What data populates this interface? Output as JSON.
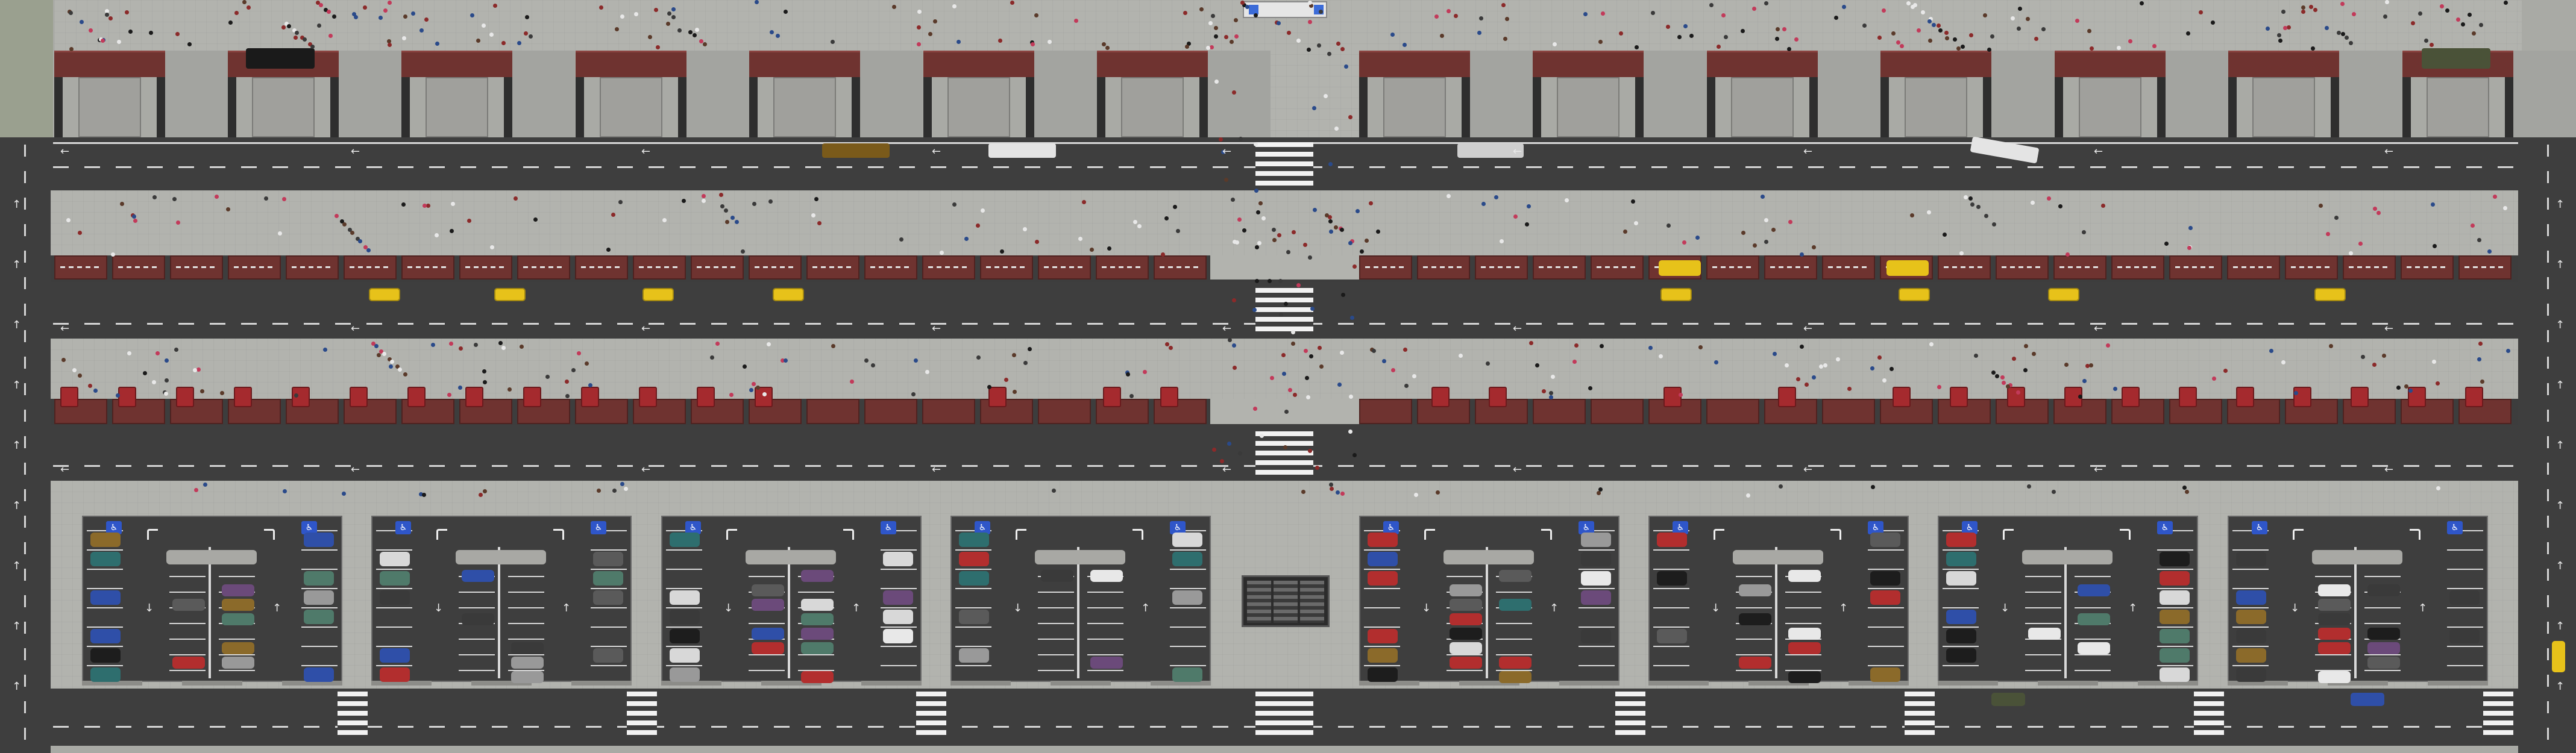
{
  "scene": {
    "description_hidden": "",
    "colors": {
      "asphalt": "#3e3e3e",
      "sidewalk": "#a9aaa5",
      "plaza": "#b2b3ae",
      "stall_roof": "#6f3330",
      "booth_red": "#a52a2e",
      "lane_white": "#d8d8d8",
      "taxi_yellow": "#e7c21a",
      "sign_blue": "#2f56c9"
    },
    "icons": {
      "direction_arrow": "arrow-icon",
      "disabled_parking": "accessible-parking-icon",
      "turn_arrow": "turn-arrow-icon",
      "ticket_machine": "ticket-machine-icon"
    },
    "accessible_sign_glyph": "♿"
  }
}
